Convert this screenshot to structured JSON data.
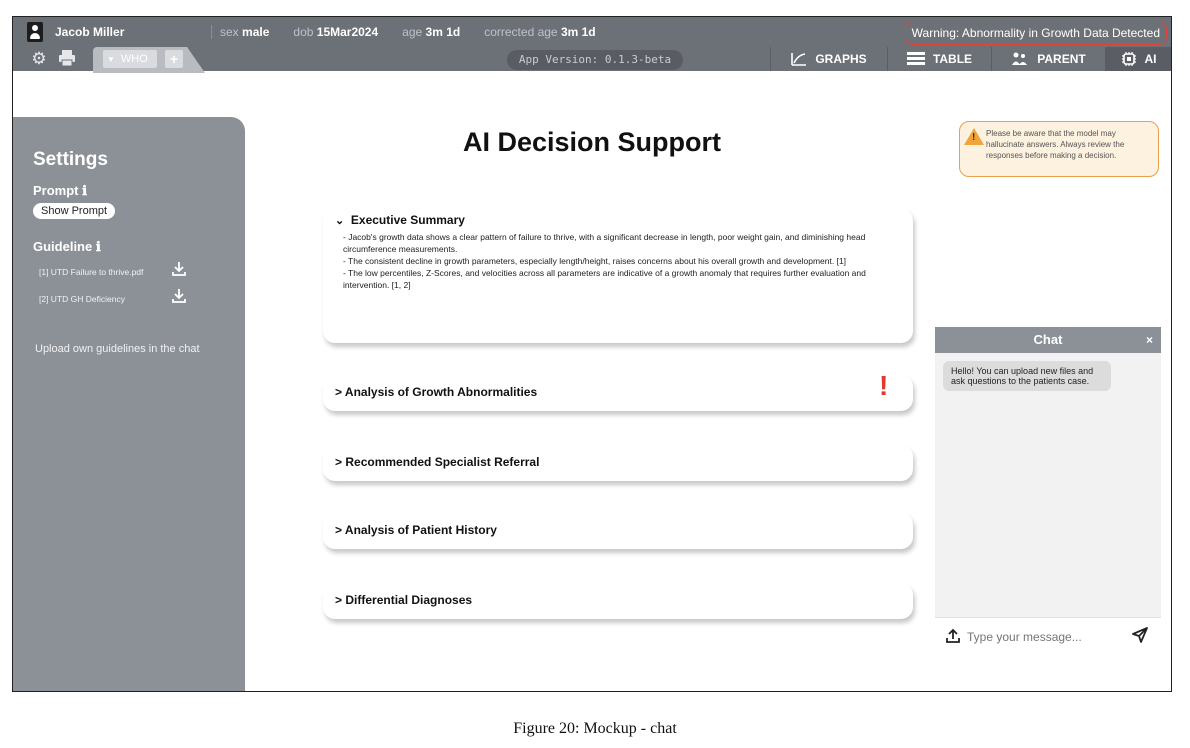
{
  "patient": {
    "name": "Jacob Miller",
    "sex_label": "sex",
    "sex": "male",
    "dob_label": "dob",
    "dob": "15Mar2024",
    "age_label": "age",
    "age": "3m 1d",
    "corrected_label": "corrected age",
    "corrected_age": "3m 1d"
  },
  "warning": "Warning: Abnormality in Growth Data Detected",
  "toolbar": {
    "who_tab": "WHO",
    "plus": "+",
    "version": "App Version: 0.1.3-beta",
    "nav": [
      {
        "label": "GRAPHS",
        "icon": "chart-line-icon"
      },
      {
        "label": "TABLE",
        "icon": "table-icon"
      },
      {
        "label": "PARENT",
        "icon": "parents-icon"
      },
      {
        "label": "AI",
        "icon": "chip-icon"
      }
    ]
  },
  "sidebar": {
    "title": "Settings",
    "prompt_label": "Prompt ℹ",
    "show_prompt": "Show Prompt",
    "guideline_label": "Guideline ℹ",
    "documents": [
      "[1] UTD Failure to thrive.pdf",
      "[2] UTD GH Deficiency"
    ],
    "upload_hint": "Upload own guidelines in the chat"
  },
  "main": {
    "title": "AI Decision Support",
    "disclaimer": "Please be aware that the model may hallucinate answers. Always review the responses before making a decision.",
    "sections": [
      {
        "header": "Executive Summary",
        "expanded": true,
        "lines": [
          "- Jacob's growth data shows a clear pattern of failure to thrive, with a significant decrease in length, poor weight gain, and diminishing head circumference measurements.",
          "- The consistent decline in growth parameters, especially length/height, raises concerns about his overall growth and development. [1]",
          "- The low percentiles, Z-Scores, and velocities across all parameters are indicative of a growth anomaly that requires further evaluation and intervention. [1, 2]"
        ]
      },
      {
        "header": "Analysis of Growth Abnormalities",
        "alert": "!"
      },
      {
        "header": "Recommended Specialist Referral"
      },
      {
        "header": "Analysis of Patient History"
      },
      {
        "header": "Differential Diagnoses"
      }
    ]
  },
  "chat": {
    "title": "Chat",
    "close": "×",
    "greeting": "Hello! You can upload new files and ask questions to the patients case.",
    "placeholder": "Type your message..."
  },
  "caption": "Figure 20: Mockup - chat"
}
